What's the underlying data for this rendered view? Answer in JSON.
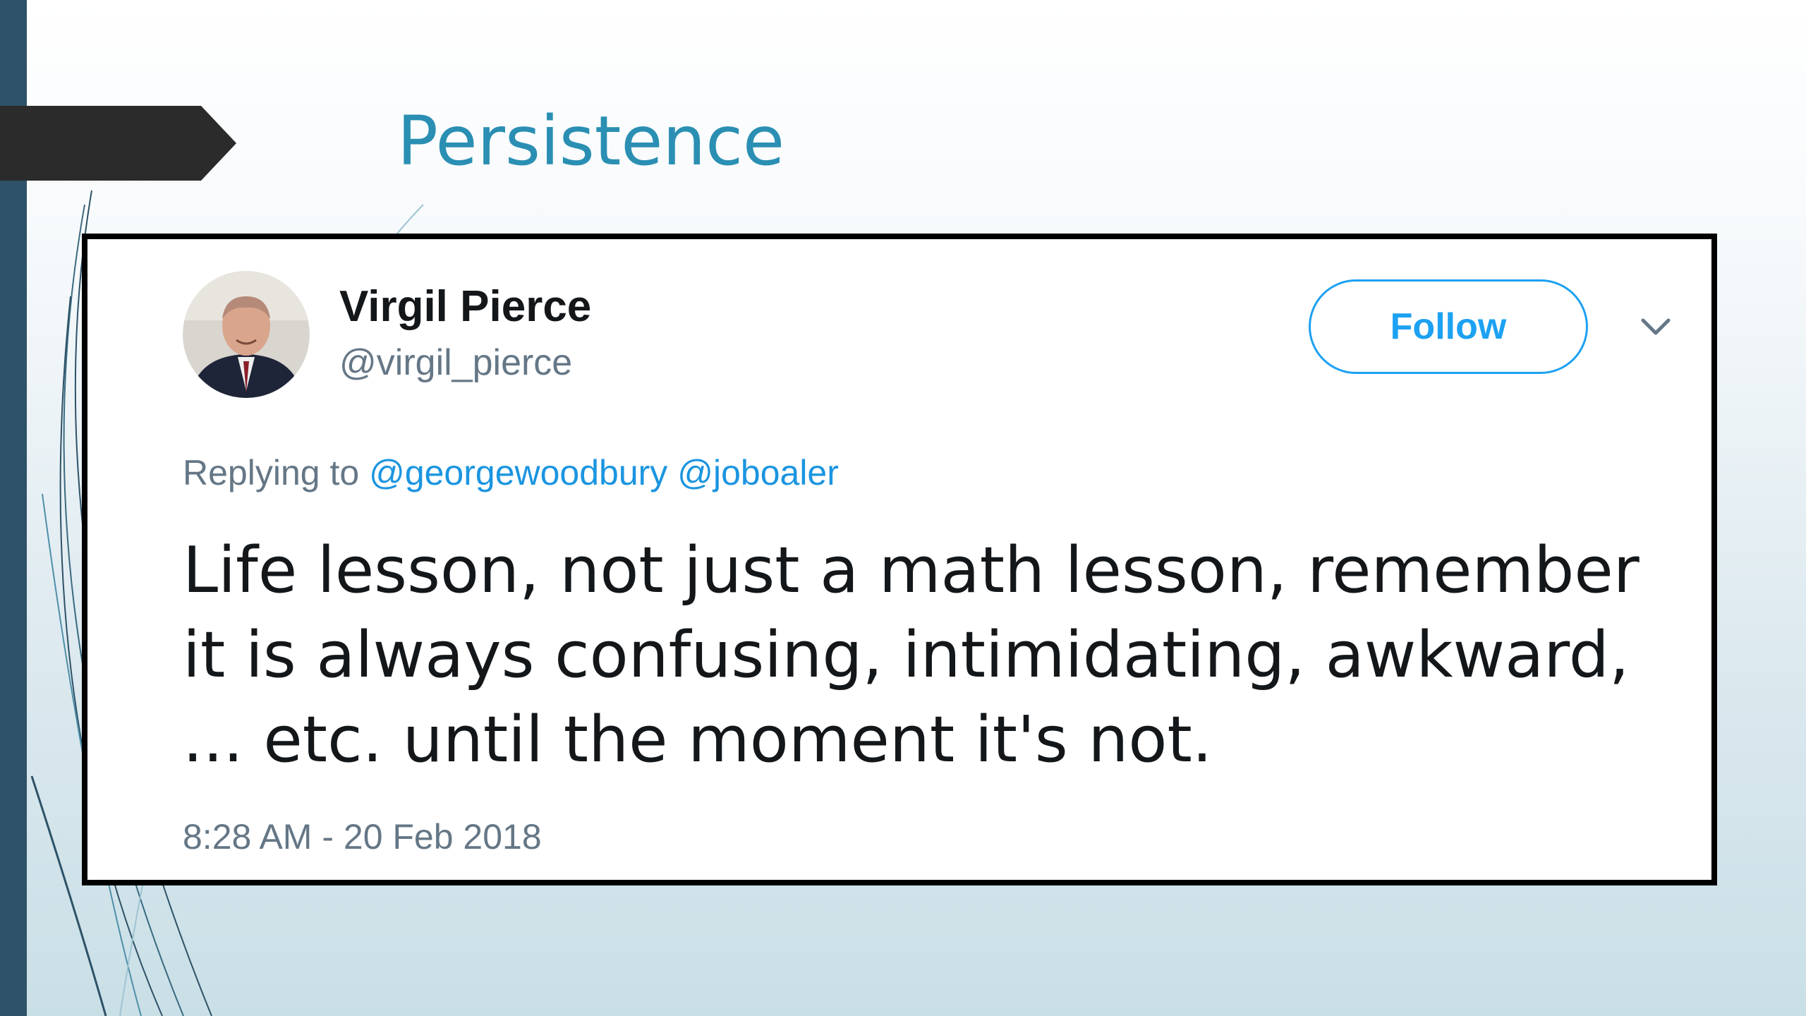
{
  "slide": {
    "title": "Persistence"
  },
  "tweet": {
    "display_name": "Virgil Pierce",
    "handle": "@virgil_pierce",
    "follow_label": "Follow",
    "replying_prefix": "Replying to",
    "reply_mentions": [
      "@georgewoodbury",
      "@joboaler"
    ],
    "text_lines": [
      "Life lesson, not just a math lesson, remember",
      "it is always confusing, intimidating, awkward,",
      "... etc. until the moment it's not."
    ],
    "timestamp": "8:28 AM - 20 Feb 2018",
    "menu_icon": "chevron-down-icon"
  },
  "colors": {
    "title": "#2a8fb3",
    "link": "#1b95e0",
    "follow": "#1da1f2",
    "secondary_text": "#657786",
    "primary_text": "#14171a",
    "left_bar": "#2e5267"
  }
}
